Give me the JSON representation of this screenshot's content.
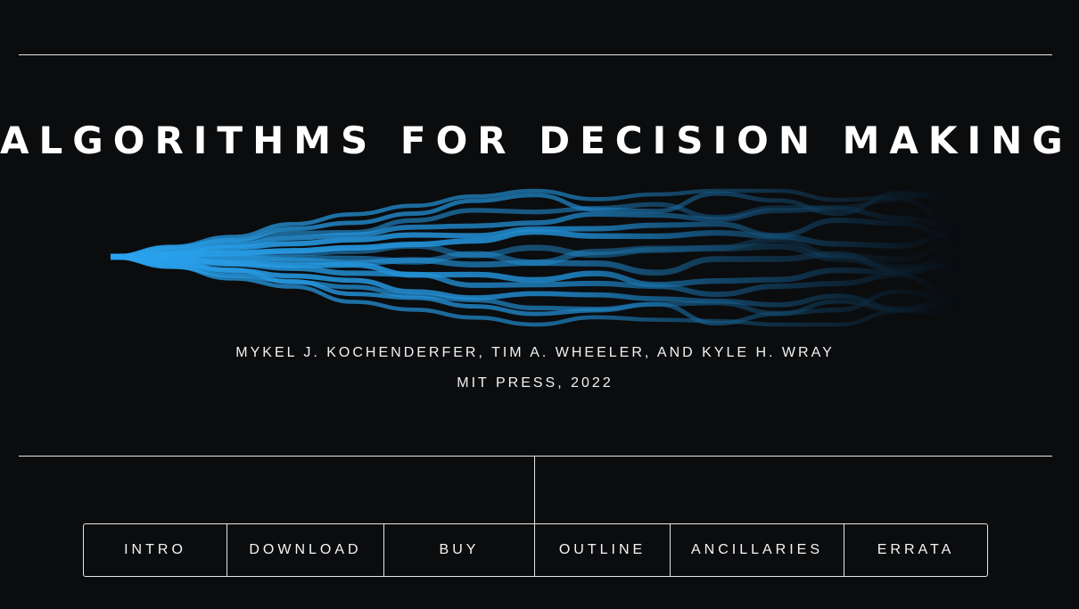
{
  "header": {
    "title": "ALGORITHMS FOR DECISION MAKING"
  },
  "hero": {
    "authors": "MYKEL J. KOCHENDERFER, TIM A. WHEELER, AND KYLE H. WRAY",
    "publisher": "MIT PRESS, 2022",
    "art_accent": "#2aa3ef"
  },
  "nav": {
    "items": [
      {
        "label": "INTRO"
      },
      {
        "label": "DOWNLOAD"
      },
      {
        "label": "BUY"
      },
      {
        "label": "OUTLINE"
      },
      {
        "label": "ANCILLARIES"
      },
      {
        "label": "ERRATA"
      }
    ]
  },
  "colors": {
    "background": "#0b0c0e",
    "text": "#ffffff",
    "rule": "#e6e6e6"
  }
}
